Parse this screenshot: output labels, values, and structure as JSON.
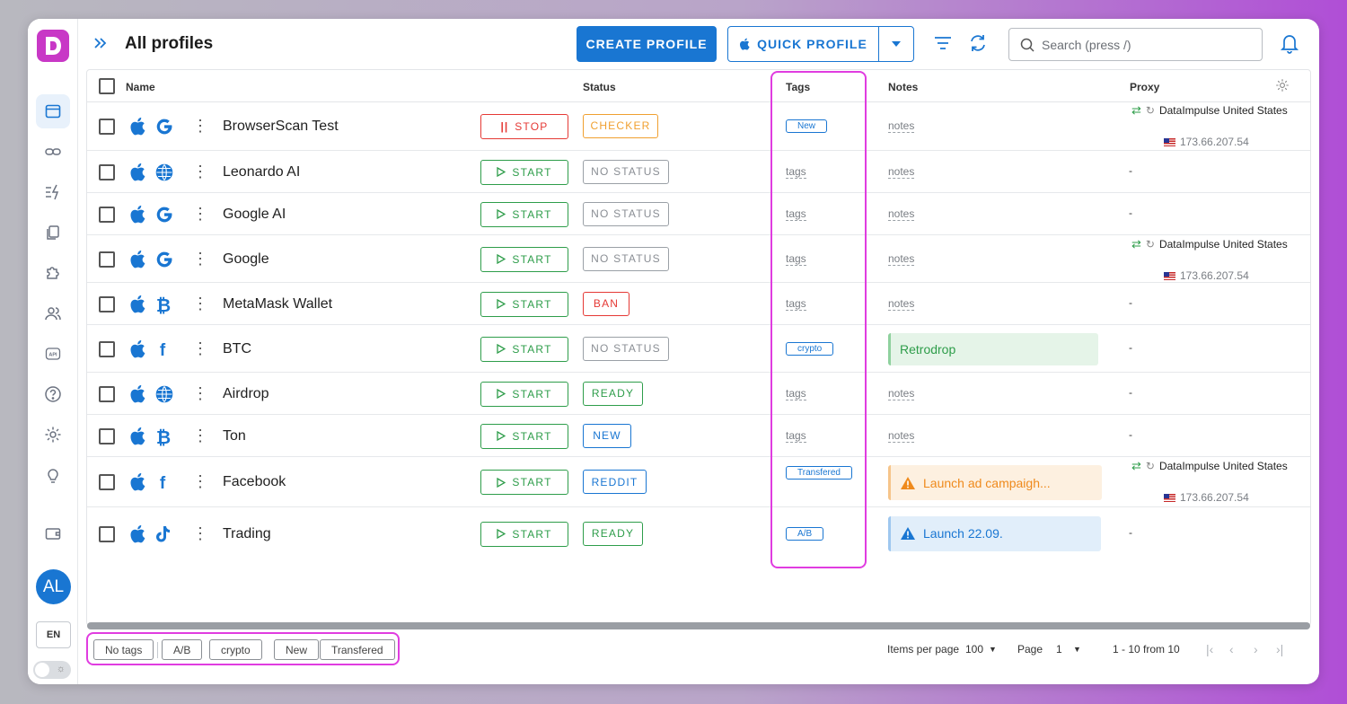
{
  "header": {
    "title": "All profiles",
    "create_profile": "CREATE PROFILE",
    "quick_profile": "QUICK PROFILE",
    "search_placeholder": "Search (press /)"
  },
  "sidebar": {
    "logo": "D",
    "avatar": "AL",
    "language": "EN"
  },
  "columns": {
    "name": "Name",
    "status": "Status",
    "tags": "Tags",
    "notes": "Notes",
    "proxy": "Proxy"
  },
  "rows": [
    {
      "name": "BrowserScan Test",
      "browser_icon": "google-icon",
      "action": "STOP",
      "status": "CHECKER",
      "tag": "New",
      "notes": "notes",
      "proxy": "DataImpulse United States",
      "ip": "173.66.207.54"
    },
    {
      "name": "Leonardo AI",
      "browser_icon": "globe-icon",
      "action": "START",
      "status": "NO STATUS",
      "tag": "tags",
      "notes": "notes",
      "proxy": "-"
    },
    {
      "name": "Google AI",
      "browser_icon": "google-icon",
      "action": "START",
      "status": "NO STATUS",
      "tag": "tags",
      "notes": "notes",
      "proxy": "-"
    },
    {
      "name": "Google",
      "browser_icon": "google-icon",
      "action": "START",
      "status": "NO STATUS",
      "tag": "tags",
      "notes": "notes",
      "proxy": "DataImpulse United States",
      "ip": "173.66.207.54"
    },
    {
      "name": "MetaMask Wallet",
      "browser_icon": "bitcoin-icon",
      "action": "START",
      "status": "BAN",
      "tag": "tags",
      "notes": "notes",
      "proxy": "-"
    },
    {
      "name": "BTC",
      "browser_icon": "facebook-icon",
      "action": "START",
      "status": "NO STATUS",
      "tag": "crypto",
      "notes": "Retrodrop",
      "proxy": "-"
    },
    {
      "name": "Airdrop",
      "browser_icon": "globe-icon",
      "action": "START",
      "status": "READY",
      "tag": "tags",
      "notes": "notes",
      "proxy": "-"
    },
    {
      "name": "Ton",
      "browser_icon": "bitcoin-icon",
      "action": "START",
      "status": "NEW",
      "tag": "tags",
      "notes": "notes",
      "proxy": "-"
    },
    {
      "name": "Facebook",
      "browser_icon": "facebook-icon",
      "action": "START",
      "status": "REDDIT",
      "tag": "Transfered",
      "notes": "Launch ad campaigh...",
      "proxy": "DataImpulse United States",
      "ip": "173.66.207.54"
    },
    {
      "name": "Trading",
      "browser_icon": "tiktok-icon",
      "action": "START",
      "status": "READY",
      "tag": "A/B",
      "notes": "Launch 22.09.",
      "proxy": "-"
    }
  ],
  "footer": {
    "filter_chips": [
      "No tags",
      "A/B",
      "crypto",
      "New",
      "Transfered"
    ],
    "items_per_page_label": "Items per page",
    "items_per_page": "100",
    "page_label": "Page",
    "page": "1",
    "range": "1 - 10 from 10"
  },
  "colors": {
    "primary": "#1976d2",
    "start": "#2e9d4a",
    "stop": "#e53935",
    "checker": "#f0a030",
    "highlight": "#e03ce0"
  }
}
